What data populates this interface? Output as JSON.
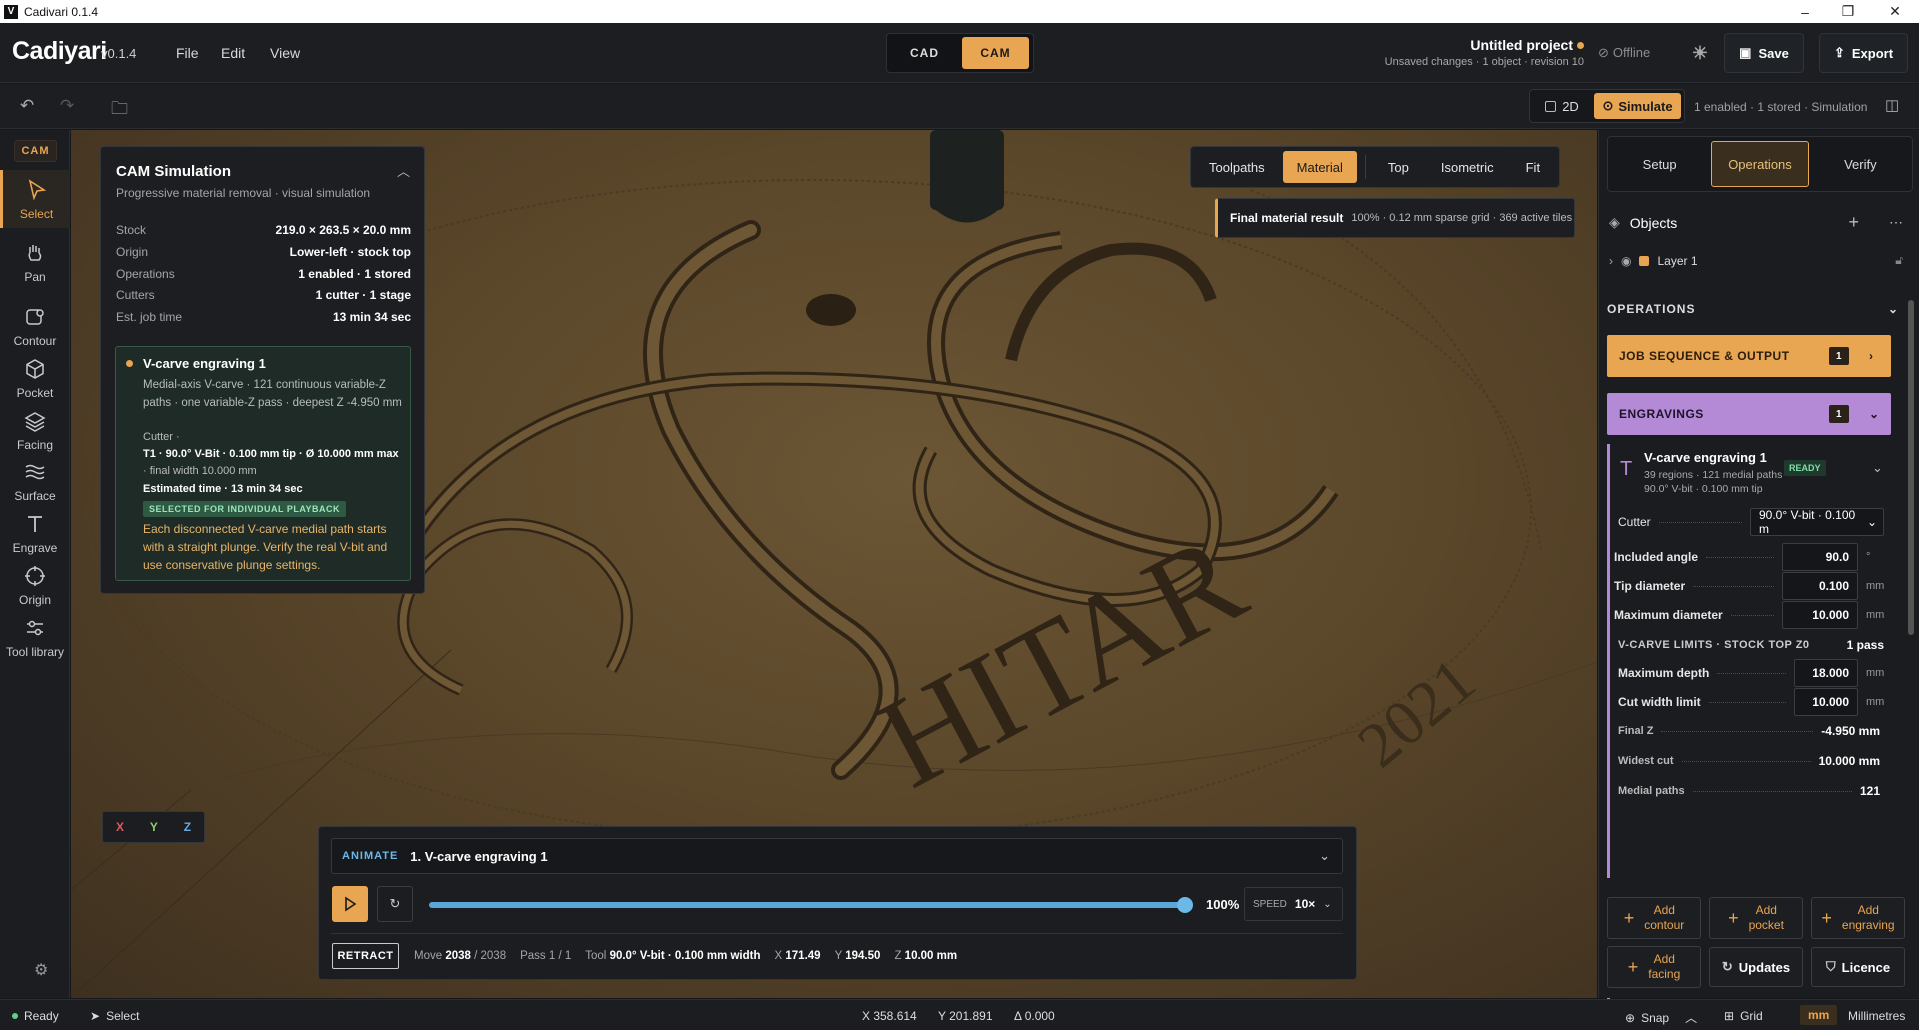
{
  "window": {
    "title": "Cadivari 0.1.4",
    "logo": "V"
  },
  "header": {
    "brand": "Cadiyari",
    "version": "v0.1.4",
    "menu": [
      "File",
      "Edit",
      "View"
    ],
    "modes": [
      "CAD",
      "CAM"
    ],
    "active_mode": "CAM",
    "project_title": "Untitled project",
    "project_sub": "Unsaved changes · 1 object · revision 10",
    "offline": "Offline",
    "save": "Save",
    "export": "Export"
  },
  "toolbar": {
    "view_2d": "2D",
    "simulate": "Simulate",
    "status": "1 enabled · 1 stored · Simulation"
  },
  "rail": {
    "tag": "CAM",
    "tools": [
      {
        "label": "Select",
        "icon": "cursor-icon"
      },
      {
        "label": "Pan",
        "icon": "hand-icon"
      },
      {
        "label": "Contour",
        "icon": "contour-icon"
      },
      {
        "label": "Pocket",
        "icon": "cube-icon"
      },
      {
        "label": "Facing",
        "icon": "layers-icon"
      },
      {
        "label": "Surface",
        "icon": "waves-icon"
      },
      {
        "label": "Engrave",
        "icon": "text-icon"
      },
      {
        "label": "Origin",
        "icon": "crosshair-icon"
      },
      {
        "label": "Tool library",
        "icon": "sliders-icon"
      }
    ]
  },
  "sim_panel": {
    "title": "CAM Simulation",
    "subtitle": "Progressive material removal · visual simulation",
    "rows": [
      {
        "k": "Stock",
        "v": "219.0 × 263.5 × 20.0 mm"
      },
      {
        "k": "Origin",
        "v": "Lower-left · stock top"
      },
      {
        "k": "Operations",
        "v": "1 enabled · 1 stored"
      },
      {
        "k": "Cutters",
        "v": "1 cutter · 1 stage"
      },
      {
        "k": "Est. job time",
        "v": "13 min 34 sec"
      }
    ],
    "op": {
      "title": "V-carve engraving 1",
      "desc": "Medial-axis V-carve · 121 continuous variable-Z paths · one variable-Z pass · deepest Z -4.950 mm",
      "cutter_label": "Cutter ·",
      "cutter": "T1 · 90.0° V-Bit · 0.100 mm tip · Ø 10.000 mm max",
      "final_width": "· final width 10.000 mm",
      "est": "Estimated time · 13 min 34 sec",
      "badge": "SELECTED FOR INDIVIDUAL PLAYBACK",
      "warning": "Each disconnected V-carve medial path starts with a straight plunge. Verify the real V-bit and use conservative plunge settings."
    }
  },
  "view_controls": {
    "buttons": [
      "Toolpaths",
      "Material",
      "Top",
      "Isometric",
      "Fit"
    ],
    "active": "Material",
    "final_title": "Final material result",
    "final_detail": "100% · 0.12 mm sparse grid · 369 active tiles"
  },
  "axes": {
    "x": "X",
    "y": "Y",
    "z": "Z"
  },
  "animate": {
    "label": "ANIMATE",
    "selection": "1. V-carve engraving 1",
    "progress": 100,
    "progress_text": "100%",
    "speed_label": "SPEED",
    "speed": "10×",
    "retract": "RETRACT",
    "move_label": "Move",
    "move": "2038",
    "move_total": "/ 2038",
    "pass": "Pass 1 / 1",
    "tool_label": "Tool",
    "tool": "90.0° V-bit · 0.100 mm width",
    "x_label": "X",
    "x": "171.49",
    "y_label": "Y",
    "y": "194.50",
    "z_label": "Z",
    "z": "10.00 mm"
  },
  "right_panel": {
    "tabs": [
      "Setup",
      "Operations",
      "Verify"
    ],
    "active_tab": "Operations",
    "objects": "Objects",
    "layer": "Layer 1",
    "operations": "OPERATIONS",
    "job_seq": "JOB SEQUENCE & OUTPUT",
    "job_count": "1",
    "engravings": "ENGRAVINGS",
    "eng_count": "1",
    "eng_title": "V-carve engraving 1",
    "eng_sub1": "39 regions · 121 medial paths ·",
    "eng_sub2": "90.0° V-bit · 0.100 mm tip",
    "ready": "READY",
    "cutter_label": "Cutter",
    "cutter_value": "90.0° V-bit · 0.100 m",
    "fields": [
      {
        "label": "Included angle",
        "value": "90.0",
        "unit": "°"
      },
      {
        "label": "Tip diameter",
        "value": "0.100",
        "unit": "mm"
      },
      {
        "label": "Maximum diameter",
        "value": "10.000",
        "unit": "mm"
      }
    ],
    "limits_title": "V-CARVE LIMITS · STOCK TOP Z0",
    "limits_pass": "1 pass",
    "limits": [
      {
        "label": "Maximum depth",
        "value": "18.000",
        "unit": "mm"
      },
      {
        "label": "Cut width limit",
        "value": "10.000",
        "unit": "mm"
      }
    ],
    "readouts": [
      {
        "label": "Final Z",
        "value": "-4.950 mm"
      },
      {
        "label": "Widest cut",
        "value": "10.000 mm"
      },
      {
        "label": "Medial paths",
        "value": "121"
      }
    ],
    "add_buttons": [
      {
        "l1": "Add",
        "l2": "contour"
      },
      {
        "l1": "Add",
        "l2": "pocket"
      },
      {
        "l1": "Add",
        "l2": "engraving"
      },
      {
        "l1": "Add",
        "l2": "facing"
      }
    ],
    "updates": "Updates",
    "licence": "Licence"
  },
  "status": {
    "ready": "Ready",
    "tool": "Select",
    "x": "X  358.614",
    "y": "Y  201.891",
    "delta": "Δ  0.000",
    "snap": "Snap",
    "grid": "Grid",
    "unit_short": "mm",
    "unit_long": "Millimetres"
  },
  "scene": {
    "text_arc": "HITAR",
    "year": "2021"
  }
}
